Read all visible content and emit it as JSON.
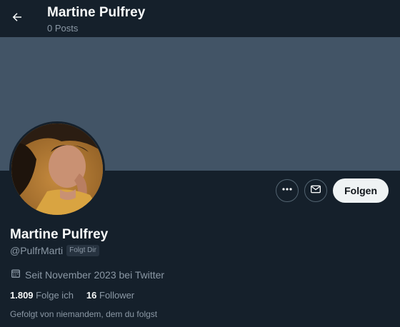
{
  "header": {
    "title": "Martine Pulfrey",
    "post_count": "0 Posts"
  },
  "profile": {
    "display_name": "Martine Pulfrey",
    "handle": "@PulfrMarti",
    "follows_you_badge": "Folgt Dir",
    "joined": "Seit November 2023 bei Twitter",
    "following_count": "1.809",
    "following_label": "Folge ich",
    "followers_count": "16",
    "followers_label": "Follower",
    "followed_by": "Gefolgt von niemandem, dem du folgst"
  },
  "actions": {
    "follow_label": "Folgen"
  },
  "icons": {
    "back": "arrow-left-icon",
    "more": "more-dots-icon",
    "message": "envelope-icon",
    "calendar": "calendar-icon"
  },
  "colors": {
    "background": "#15202b",
    "banner": "#425466",
    "follow_button_bg": "#eff3f4",
    "secondary_text": "#8b98a5"
  }
}
